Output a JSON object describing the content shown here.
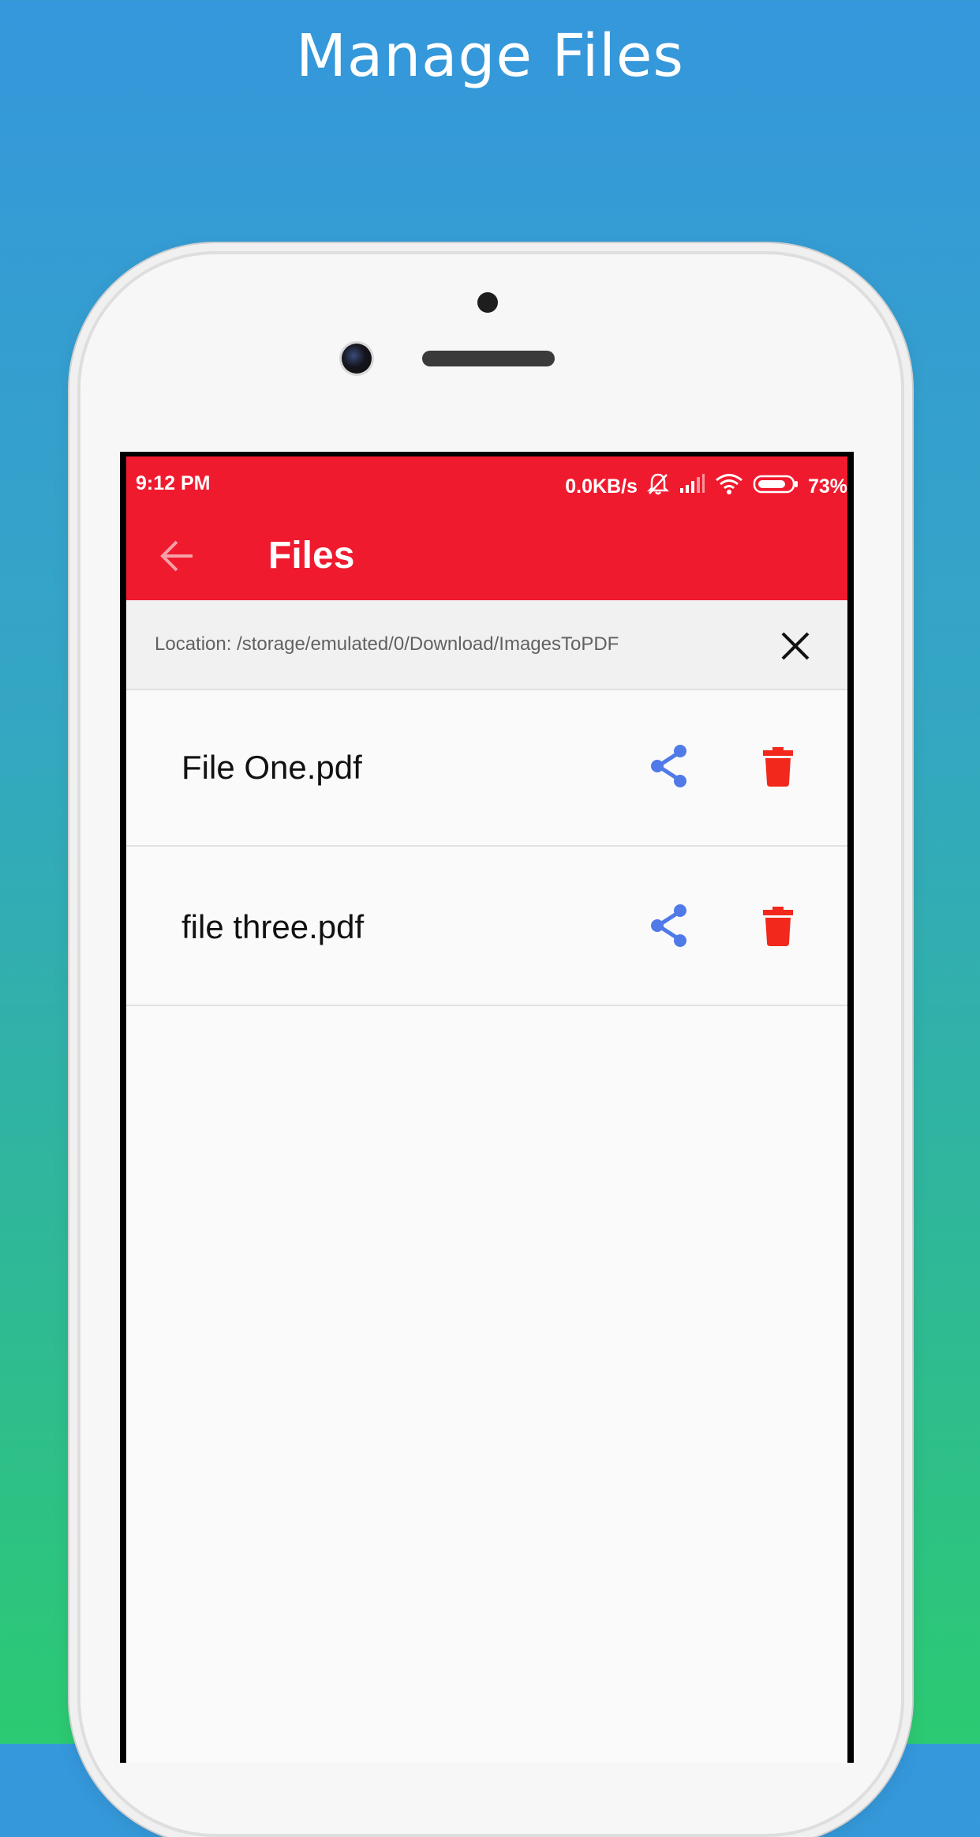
{
  "promo": {
    "title": "Manage Files"
  },
  "status_bar": {
    "time": "9:12 PM",
    "network_speed": "0.0KB/s",
    "battery_percent": "73%"
  },
  "app_bar": {
    "title": "Files"
  },
  "location_bar": {
    "text": "Location: /storage/emulated/0/Download/ImagesToPDF"
  },
  "files": [
    {
      "name": "File One.pdf"
    },
    {
      "name": "file three.pdf"
    }
  ],
  "colors": {
    "accent": "#f01a2e",
    "share_icon": "#4f7ae8",
    "delete_icon": "#f3281c"
  },
  "icons": [
    "back-arrow-icon",
    "close-icon",
    "share-icon",
    "trash-icon",
    "mute-bell-icon",
    "signal-icon",
    "wifi-icon",
    "battery-icon"
  ]
}
